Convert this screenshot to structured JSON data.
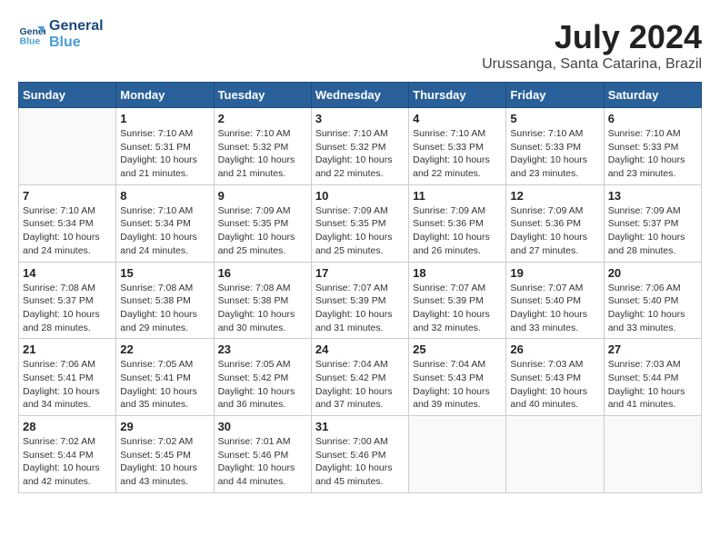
{
  "header": {
    "logo_line1": "General",
    "logo_line2": "Blue",
    "month_year": "July 2024",
    "location": "Urussanga, Santa Catarina, Brazil"
  },
  "days_of_week": [
    "Sunday",
    "Monday",
    "Tuesday",
    "Wednesday",
    "Thursday",
    "Friday",
    "Saturday"
  ],
  "weeks": [
    [
      {
        "day": null,
        "info": ""
      },
      {
        "day": "1",
        "info": "Sunrise: 7:10 AM\nSunset: 5:31 PM\nDaylight: 10 hours\nand 21 minutes."
      },
      {
        "day": "2",
        "info": "Sunrise: 7:10 AM\nSunset: 5:32 PM\nDaylight: 10 hours\nand 21 minutes."
      },
      {
        "day": "3",
        "info": "Sunrise: 7:10 AM\nSunset: 5:32 PM\nDaylight: 10 hours\nand 22 minutes."
      },
      {
        "day": "4",
        "info": "Sunrise: 7:10 AM\nSunset: 5:33 PM\nDaylight: 10 hours\nand 22 minutes."
      },
      {
        "day": "5",
        "info": "Sunrise: 7:10 AM\nSunset: 5:33 PM\nDaylight: 10 hours\nand 23 minutes."
      },
      {
        "day": "6",
        "info": "Sunrise: 7:10 AM\nSunset: 5:33 PM\nDaylight: 10 hours\nand 23 minutes."
      }
    ],
    [
      {
        "day": "7",
        "info": "Sunrise: 7:10 AM\nSunset: 5:34 PM\nDaylight: 10 hours\nand 24 minutes."
      },
      {
        "day": "8",
        "info": "Sunrise: 7:10 AM\nSunset: 5:34 PM\nDaylight: 10 hours\nand 24 minutes."
      },
      {
        "day": "9",
        "info": "Sunrise: 7:09 AM\nSunset: 5:35 PM\nDaylight: 10 hours\nand 25 minutes."
      },
      {
        "day": "10",
        "info": "Sunrise: 7:09 AM\nSunset: 5:35 PM\nDaylight: 10 hours\nand 25 minutes."
      },
      {
        "day": "11",
        "info": "Sunrise: 7:09 AM\nSunset: 5:36 PM\nDaylight: 10 hours\nand 26 minutes."
      },
      {
        "day": "12",
        "info": "Sunrise: 7:09 AM\nSunset: 5:36 PM\nDaylight: 10 hours\nand 27 minutes."
      },
      {
        "day": "13",
        "info": "Sunrise: 7:09 AM\nSunset: 5:37 PM\nDaylight: 10 hours\nand 28 minutes."
      }
    ],
    [
      {
        "day": "14",
        "info": "Sunrise: 7:08 AM\nSunset: 5:37 PM\nDaylight: 10 hours\nand 28 minutes."
      },
      {
        "day": "15",
        "info": "Sunrise: 7:08 AM\nSunset: 5:38 PM\nDaylight: 10 hours\nand 29 minutes."
      },
      {
        "day": "16",
        "info": "Sunrise: 7:08 AM\nSunset: 5:38 PM\nDaylight: 10 hours\nand 30 minutes."
      },
      {
        "day": "17",
        "info": "Sunrise: 7:07 AM\nSunset: 5:39 PM\nDaylight: 10 hours\nand 31 minutes."
      },
      {
        "day": "18",
        "info": "Sunrise: 7:07 AM\nSunset: 5:39 PM\nDaylight: 10 hours\nand 32 minutes."
      },
      {
        "day": "19",
        "info": "Sunrise: 7:07 AM\nSunset: 5:40 PM\nDaylight: 10 hours\nand 33 minutes."
      },
      {
        "day": "20",
        "info": "Sunrise: 7:06 AM\nSunset: 5:40 PM\nDaylight: 10 hours\nand 33 minutes."
      }
    ],
    [
      {
        "day": "21",
        "info": "Sunrise: 7:06 AM\nSunset: 5:41 PM\nDaylight: 10 hours\nand 34 minutes."
      },
      {
        "day": "22",
        "info": "Sunrise: 7:05 AM\nSunset: 5:41 PM\nDaylight: 10 hours\nand 35 minutes."
      },
      {
        "day": "23",
        "info": "Sunrise: 7:05 AM\nSunset: 5:42 PM\nDaylight: 10 hours\nand 36 minutes."
      },
      {
        "day": "24",
        "info": "Sunrise: 7:04 AM\nSunset: 5:42 PM\nDaylight: 10 hours\nand 37 minutes."
      },
      {
        "day": "25",
        "info": "Sunrise: 7:04 AM\nSunset: 5:43 PM\nDaylight: 10 hours\nand 39 minutes."
      },
      {
        "day": "26",
        "info": "Sunrise: 7:03 AM\nSunset: 5:43 PM\nDaylight: 10 hours\nand 40 minutes."
      },
      {
        "day": "27",
        "info": "Sunrise: 7:03 AM\nSunset: 5:44 PM\nDaylight: 10 hours\nand 41 minutes."
      }
    ],
    [
      {
        "day": "28",
        "info": "Sunrise: 7:02 AM\nSunset: 5:44 PM\nDaylight: 10 hours\nand 42 minutes."
      },
      {
        "day": "29",
        "info": "Sunrise: 7:02 AM\nSunset: 5:45 PM\nDaylight: 10 hours\nand 43 minutes."
      },
      {
        "day": "30",
        "info": "Sunrise: 7:01 AM\nSunset: 5:46 PM\nDaylight: 10 hours\nand 44 minutes."
      },
      {
        "day": "31",
        "info": "Sunrise: 7:00 AM\nSunset: 5:46 PM\nDaylight: 10 hours\nand 45 minutes."
      },
      {
        "day": null,
        "info": ""
      },
      {
        "day": null,
        "info": ""
      },
      {
        "day": null,
        "info": ""
      }
    ]
  ]
}
